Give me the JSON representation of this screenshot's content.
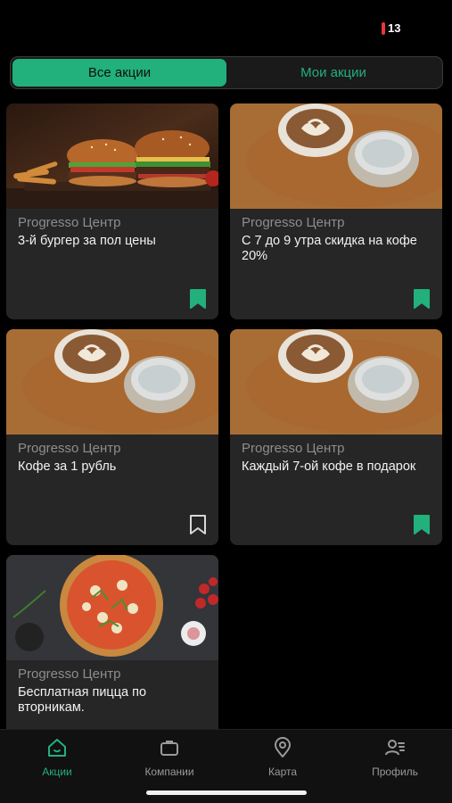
{
  "status": {
    "battery_level": "13"
  },
  "tabs_segment": {
    "all_label": "Все акции",
    "mine_label": "Мои акции"
  },
  "promos": [
    {
      "venue": "Progresso Центр",
      "title": "3-й бургер за пол цены",
      "image": "burgers",
      "saved": true
    },
    {
      "venue": "Progresso Центр",
      "title": "С 7 до 9 утра  скидка на кофе 20%",
      "image": "coffee",
      "saved": true
    },
    {
      "venue": "Progresso Центр",
      "title": "Кофе за 1 рубль",
      "image": "coffee",
      "saved": false
    },
    {
      "venue": "Progresso Центр",
      "title": "Каждый 7-ой кофе в подарок",
      "image": "coffee",
      "saved": true
    },
    {
      "venue": "Progresso Центр",
      "title": "Бесплатная пицца по вторникам.",
      "image": "pizza",
      "saved": false
    }
  ],
  "nav": {
    "promos": {
      "label": "Акции",
      "icon": "home-icon"
    },
    "companies": {
      "label": "Компании",
      "icon": "briefcase-icon"
    },
    "map": {
      "label": "Карта",
      "icon": "map-pin-icon"
    },
    "profile": {
      "label": "Профиль",
      "icon": "profile-icon"
    }
  },
  "colors": {
    "accent": "#22b07d",
    "card": "#262626",
    "background": "#000000"
  }
}
